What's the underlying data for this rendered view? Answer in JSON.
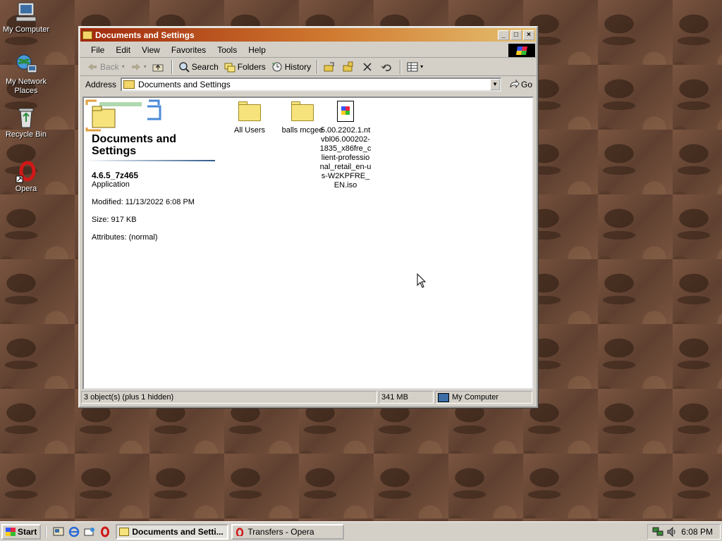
{
  "desktop": {
    "icons": [
      {
        "label": "My Computer"
      },
      {
        "label": "My Network Places"
      },
      {
        "label": "Recycle Bin"
      },
      {
        "label": "Opera"
      }
    ]
  },
  "window": {
    "title": "Documents and Settings",
    "menu": [
      "File",
      "Edit",
      "View",
      "Favorites",
      "Tools",
      "Help"
    ],
    "toolbar": {
      "back": "Back",
      "search": "Search",
      "folders": "Folders",
      "history": "History"
    },
    "address": {
      "label": "Address",
      "value": "Documents and Settings",
      "go": "Go"
    },
    "left_pane": {
      "title": "Documents and Settings",
      "selected_name": "4.6.5_7z465",
      "selected_type": "Application",
      "modified": "Modified: 11/13/2022 6:08 PM",
      "size": "Size: 917 KB",
      "attributes": "Attributes: (normal)"
    },
    "files": [
      {
        "name": "All Users",
        "kind": "folder"
      },
      {
        "name": "balls mcgee",
        "kind": "folder"
      },
      {
        "name": "5.00.2202.1.ntvbl06.000202-1835_x86fre_client-professional_retail_en-us-W2KPFRE_EN.iso",
        "kind": "iso"
      }
    ],
    "status": {
      "objects": "3 object(s) (plus 1 hidden)",
      "size": "341 MB",
      "zone": "My Computer"
    }
  },
  "taskbar": {
    "start": "Start",
    "tasks": [
      {
        "label": "Documents and Setti...",
        "active": true
      },
      {
        "label": "Transfers - Opera",
        "active": false
      }
    ],
    "clock": "6:08 PM"
  }
}
